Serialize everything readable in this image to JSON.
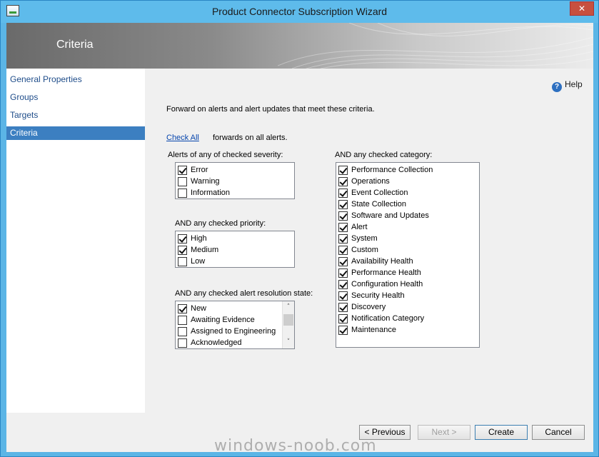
{
  "window": {
    "title": "Product Connector Subscription Wizard",
    "close_glyph": "✕"
  },
  "banner": {
    "title": "Criteria"
  },
  "nav": {
    "items": [
      {
        "label": "General Properties"
      },
      {
        "label": "Groups"
      },
      {
        "label": "Targets"
      },
      {
        "label": "Criteria",
        "selected": true
      }
    ]
  },
  "content": {
    "help_label": "Help",
    "help_glyph": "?",
    "intro": "Forward on alerts and alert updates that meet these criteria.",
    "check_all_link": "Check All",
    "check_all_text": "forwards on all alerts.",
    "severity": {
      "label": "Alerts of any of checked severity:",
      "items": [
        {
          "label": "Error",
          "checked": true
        },
        {
          "label": "Warning",
          "checked": false
        },
        {
          "label": "Information",
          "checked": false
        }
      ]
    },
    "priority": {
      "label": "AND any checked priority:",
      "items": [
        {
          "label": "High",
          "checked": true
        },
        {
          "label": "Medium",
          "checked": true
        },
        {
          "label": "Low",
          "checked": false
        }
      ]
    },
    "resolution": {
      "label": "AND any checked alert resolution state:",
      "items": [
        {
          "label": "New",
          "checked": true
        },
        {
          "label": "Awaiting Evidence",
          "checked": false
        },
        {
          "label": "Assigned to Engineering",
          "checked": false
        },
        {
          "label": "Acknowledged",
          "checked": false
        }
      ],
      "scroll_up_glyph": "˄",
      "scroll_down_glyph": "˅"
    },
    "category": {
      "label": "AND any checked category:",
      "items": [
        {
          "label": "Performance Collection",
          "checked": true
        },
        {
          "label": "Operations",
          "checked": true
        },
        {
          "label": "Event Collection",
          "checked": true
        },
        {
          "label": "State Collection",
          "checked": true
        },
        {
          "label": "Software and Updates",
          "checked": true
        },
        {
          "label": "Alert",
          "checked": true
        },
        {
          "label": "System",
          "checked": true
        },
        {
          "label": "Custom",
          "checked": true
        },
        {
          "label": "Availability Health",
          "checked": true
        },
        {
          "label": "Performance Health",
          "checked": true
        },
        {
          "label": "Configuration Health",
          "checked": true
        },
        {
          "label": "Security Health",
          "checked": true
        },
        {
          "label": "Discovery",
          "checked": true
        },
        {
          "label": "Notification Category",
          "checked": true
        },
        {
          "label": "Maintenance",
          "checked": true
        }
      ]
    }
  },
  "footer": {
    "previous": "< Previous",
    "next": "Next >",
    "create": "Create",
    "cancel": "Cancel"
  },
  "watermark": "windows-noob.com"
}
